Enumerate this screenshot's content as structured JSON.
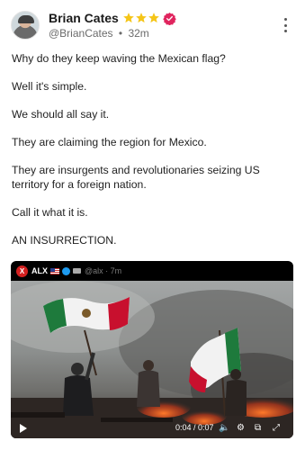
{
  "author": {
    "name": "Brian Cates",
    "handle": "@BrianCates",
    "separator": "•",
    "time": "32m",
    "star_color": "#f5c518",
    "badge_color": "#e0245e"
  },
  "post": {
    "paragraphs": [
      "Why do they keep waving the Mexican flag?",
      "Well it's simple.",
      "We should all say it.",
      "They are claiming the region for Mexico.",
      "They are insurgents and revolutionaries seizing US territory for a foreign nation.",
      "Call it what it is.",
      "AN INSURRECTION."
    ]
  },
  "media": {
    "embed_logo": "X",
    "embed_name": "ALX",
    "embed_handle": "@alx · 7m",
    "time_display": "0:04 / 0:07",
    "progress": 0.57,
    "icons": [
      "play-icon",
      "volume-icon",
      "settings-icon",
      "pip-icon",
      "fullscreen-icon"
    ]
  }
}
